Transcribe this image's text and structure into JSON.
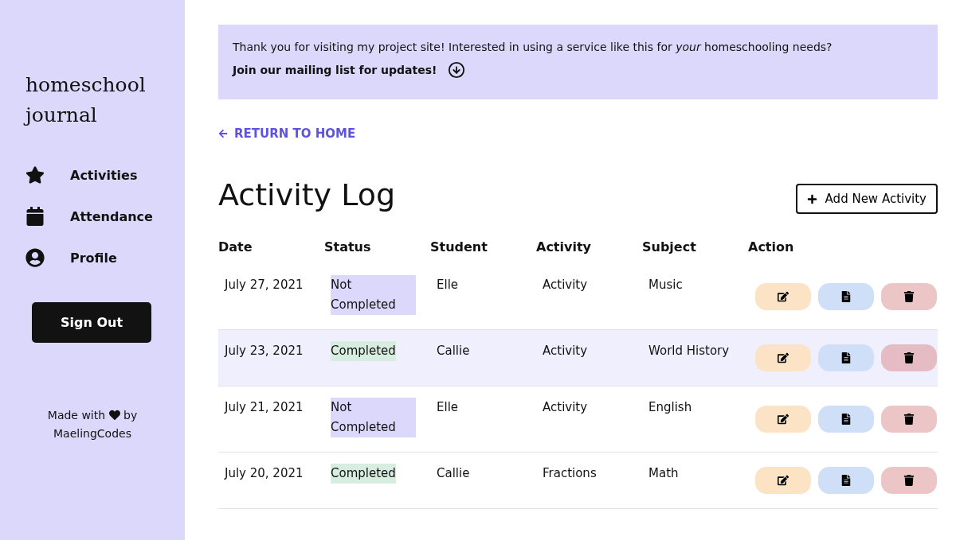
{
  "sidebar": {
    "logo": "homeschool journal",
    "nav": [
      {
        "label": "Activities"
      },
      {
        "label": "Attendance"
      },
      {
        "label": "Profile"
      }
    ],
    "sign_out": "Sign Out",
    "footer": {
      "before": "Made with",
      "after": "by",
      "author": "MaelingCodes"
    }
  },
  "banner": {
    "message": "Thank you for visiting my project site! Interested in using a service like this for *your* homeschooling needs?",
    "cta": "Join our mailing list for updates!"
  },
  "back_link": "RETURN TO HOME",
  "title": "Activity Log",
  "add_button": "Add New Activity",
  "table": {
    "columns": [
      "Date",
      "Status",
      "Student",
      "Activity",
      "Subject",
      "Action"
    ],
    "rows": [
      {
        "date": "July 27, 2021",
        "status": "Not Completed",
        "completed": false,
        "student": "Elle",
        "activity": "Activity",
        "subject": "Music",
        "selected": false
      },
      {
        "date": "July 23, 2021",
        "status": "Completed",
        "completed": true,
        "student": "Callie",
        "activity": "Activity",
        "subject": "World History",
        "selected": true
      },
      {
        "date": "July 21, 2021",
        "status": "Not Completed",
        "completed": false,
        "student": "Elle",
        "activity": "Activity",
        "subject": "English",
        "selected": false
      },
      {
        "date": "July 20, 2021",
        "status": "Completed",
        "completed": true,
        "student": "Callie",
        "activity": "Fractions",
        "subject": "Math",
        "selected": false
      }
    ]
  }
}
